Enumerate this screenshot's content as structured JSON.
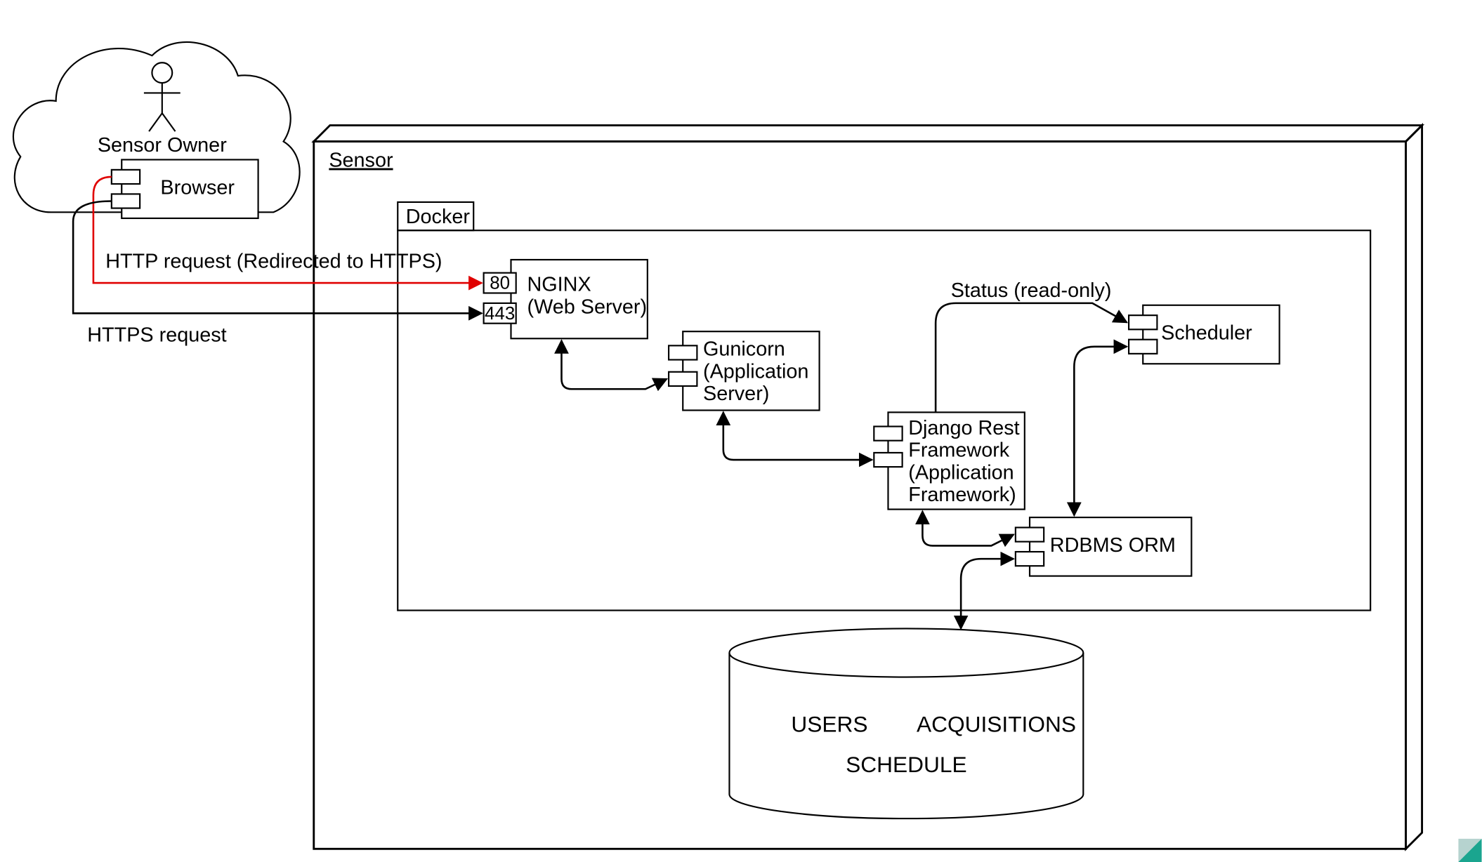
{
  "actor": {
    "label": "Sensor Owner"
  },
  "browser": {
    "label": "Browser"
  },
  "sensor": {
    "label": "Sensor"
  },
  "docker": {
    "label": "Docker"
  },
  "nginx": {
    "title": "NGINX",
    "subtitle": "(Web Server)",
    "port80": "80",
    "port443": "443"
  },
  "gunicorn": {
    "title": "Gunicorn",
    "sub1": "(Application",
    "sub2": "Server)"
  },
  "django": {
    "l1": "Django Rest",
    "l2": "Framework",
    "l3": "(Application",
    "l4": "Framework)"
  },
  "scheduler": {
    "label": "Scheduler"
  },
  "orm": {
    "label": "RDBMS ORM"
  },
  "db": {
    "users": "USERS",
    "acquisitions": "ACQUISITIONS",
    "schedule": "SCHEDULE"
  },
  "edges": {
    "http": "HTTP request (Redirected to HTTPS)",
    "https": "HTTPS request",
    "status": "Status (read-only)"
  }
}
